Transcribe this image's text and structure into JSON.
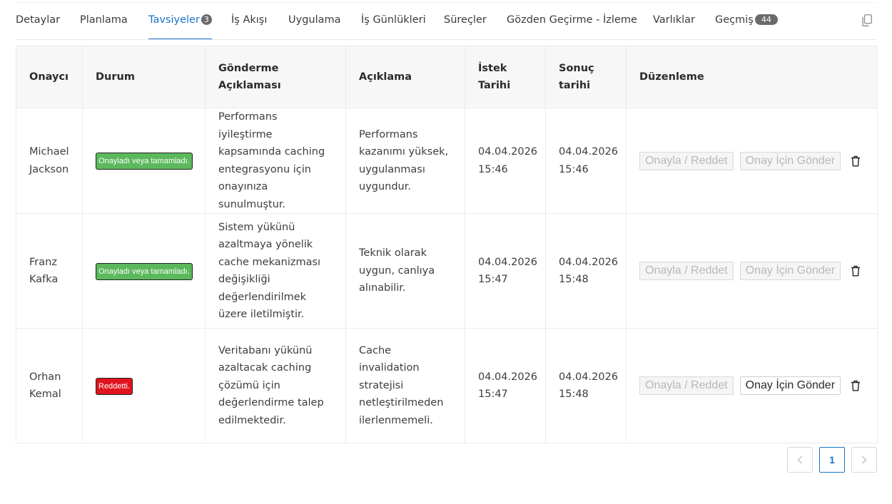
{
  "tabs": [
    {
      "label": "Detaylar",
      "badge": null,
      "active": false
    },
    {
      "label": "Planlama",
      "badge": null,
      "active": false
    },
    {
      "label": "Tavsiyeler",
      "badge": "3",
      "active": true
    },
    {
      "label": "İş Akışı",
      "badge": null,
      "active": false
    },
    {
      "label": "Uygulama",
      "badge": null,
      "active": false
    },
    {
      "label": "İş Günlükleri",
      "badge": null,
      "active": false
    },
    {
      "label": "Süreçler",
      "badge": null,
      "active": false
    },
    {
      "label": "Gözden Geçirme - İzleme",
      "badge": null,
      "active": false
    },
    {
      "label": "Varlıklar",
      "badge": null,
      "active": false
    },
    {
      "label": "Geçmiş",
      "badge": "44",
      "active": false
    }
  ],
  "table": {
    "headers": {
      "approver": "Onaycı",
      "status": "Durum",
      "submit_description": "Gönderme Açıklaması",
      "description": "Açıklama",
      "request_date": "İstek Tarihi",
      "result_date": "Sonuç tarihi",
      "edit": "Düzenleme"
    },
    "rows": [
      {
        "approver": "Michael Jackson",
        "status": "Onayladı veya tamamladı.",
        "status_color": "#5cb85c",
        "submit_description": "Performans iyileştirme kapsamında caching entegrasyonu için onayınıza sunulmuştur.",
        "description": "Performans kazanımı yüksek, uygulanması uygundur.",
        "request_date": "04.04.2026",
        "request_time": "15:46",
        "result_date": "04.04.2026",
        "result_time": "15:46",
        "approve_label": "Onayla / Reddet",
        "send_label": "Onay İçin Gönder",
        "send_enabled": false
      },
      {
        "approver": "Franz Kafka",
        "status": "Onayladı veya tamamladı.",
        "status_color": "#5cb85c",
        "submit_description": "Sistem yükünü azaltmaya yönelik cache mekanizması değişikliği değerlendirilmek üzere iletilmiştir.",
        "description": "Teknik olarak uygun, canlıya alınabilir.",
        "request_date": "04.04.2026",
        "request_time": "15:47",
        "result_date": "04.04.2026",
        "result_time": "15:48",
        "approve_label": "Onayla / Reddet",
        "send_label": "Onay İçin Gönder",
        "send_enabled": false
      },
      {
        "approver": "Orhan Kemal",
        "status": "Reddetti.",
        "status_color": "#e0141e",
        "submit_description": "Veritabanı yükünü azaltacak caching çözümü için değerlendirme talep edilmektedir.",
        "description": "Cache invalidation stratejisi netleştirilmeden ilerlenmemeli.",
        "request_date": "04.04.2026",
        "request_time": "15:47",
        "result_date": "04.04.2026",
        "result_time": "15:48",
        "approve_label": "Onayla / Reddet",
        "send_label": "Onay İçin Gönder",
        "send_enabled": true
      }
    ]
  },
  "pagination": {
    "prev_icon": "chevron-left-icon",
    "current_page": "1",
    "next_icon": "chevron-right-icon"
  },
  "icons": {
    "copy": "copy-icon",
    "delete": "trash-icon"
  },
  "colors": {
    "accent": "#1a73c9",
    "approved": "#5cb85c",
    "rejected": "#e0141e"
  }
}
